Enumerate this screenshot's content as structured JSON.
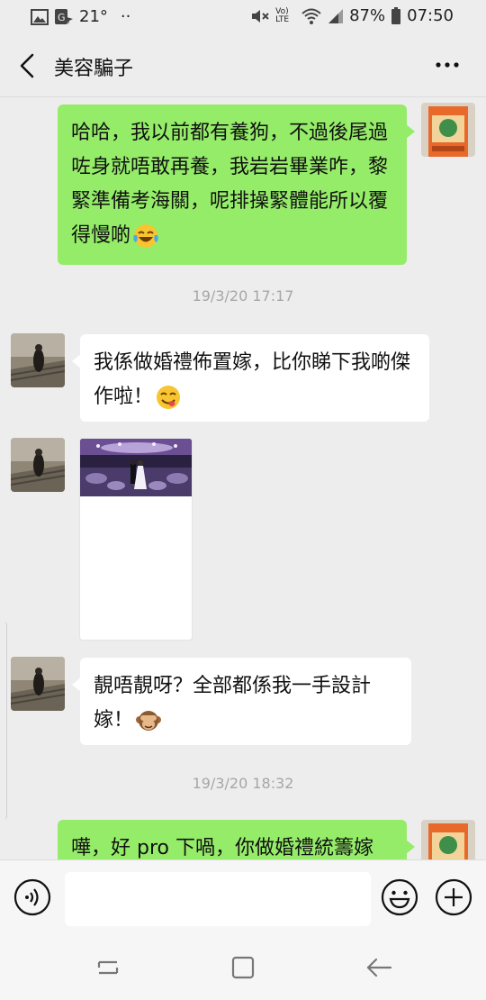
{
  "status_bar": {
    "temperature": "21°",
    "dots": "··",
    "network": "Vo) LTE",
    "battery": "87%",
    "time": "07:50"
  },
  "header": {
    "title": "美容騙子"
  },
  "messages": [
    {
      "side": "right",
      "type": "text",
      "text": "哈哈，我以前都有養狗，不過後尾過咗身就唔敢再養，我岩岩畢業咋，黎緊準備考海關，呢排操緊體能所以覆得慢啲",
      "emoji": "face-with-tears-of-joy"
    },
    {
      "type": "timestamp",
      "text": "19/3/20 17:17"
    },
    {
      "side": "left",
      "type": "text",
      "text": "我係做婚禮佈置嫁，比你睇下我啲傑作啦！",
      "emoji": "face-savoring-food"
    },
    {
      "side": "left",
      "type": "image"
    },
    {
      "side": "left",
      "type": "text",
      "text": "靚唔靚呀？全部都係我一手設計嫁！",
      "emoji": "see-no-evil-monkey"
    },
    {
      "type": "timestamp",
      "text": "19/3/20 18:32"
    },
    {
      "side": "right",
      "type": "text",
      "text": "嘩，好 pro 下喎，你做婚禮統籌嫁"
    }
  ],
  "colors": {
    "sent_bubble": "#95ec69",
    "received_bubble": "#ffffff",
    "background": "#ededed"
  }
}
